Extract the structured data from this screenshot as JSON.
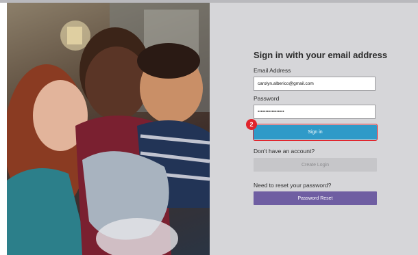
{
  "form": {
    "title": "Sign in with your email address",
    "email_label": "Email Address",
    "email_value": "carolyn.alberico@gmail.com",
    "password_label": "Password",
    "password_value": "•••••••••••••••••",
    "signin_label": "Sign in",
    "no_account_text": "Don't have an account?",
    "create_login_label": "Create Login",
    "reset_prompt_text": "Need to reset your password?",
    "reset_button_label": "Password Reset"
  },
  "annotation": {
    "step_number": "2",
    "highlight_color": "#e0242c"
  },
  "colors": {
    "signin_button": "#2f9ac8",
    "reset_button": "#6f5ea2",
    "create_button": "#c6c6c9",
    "panel_background": "#d6d6d9"
  }
}
